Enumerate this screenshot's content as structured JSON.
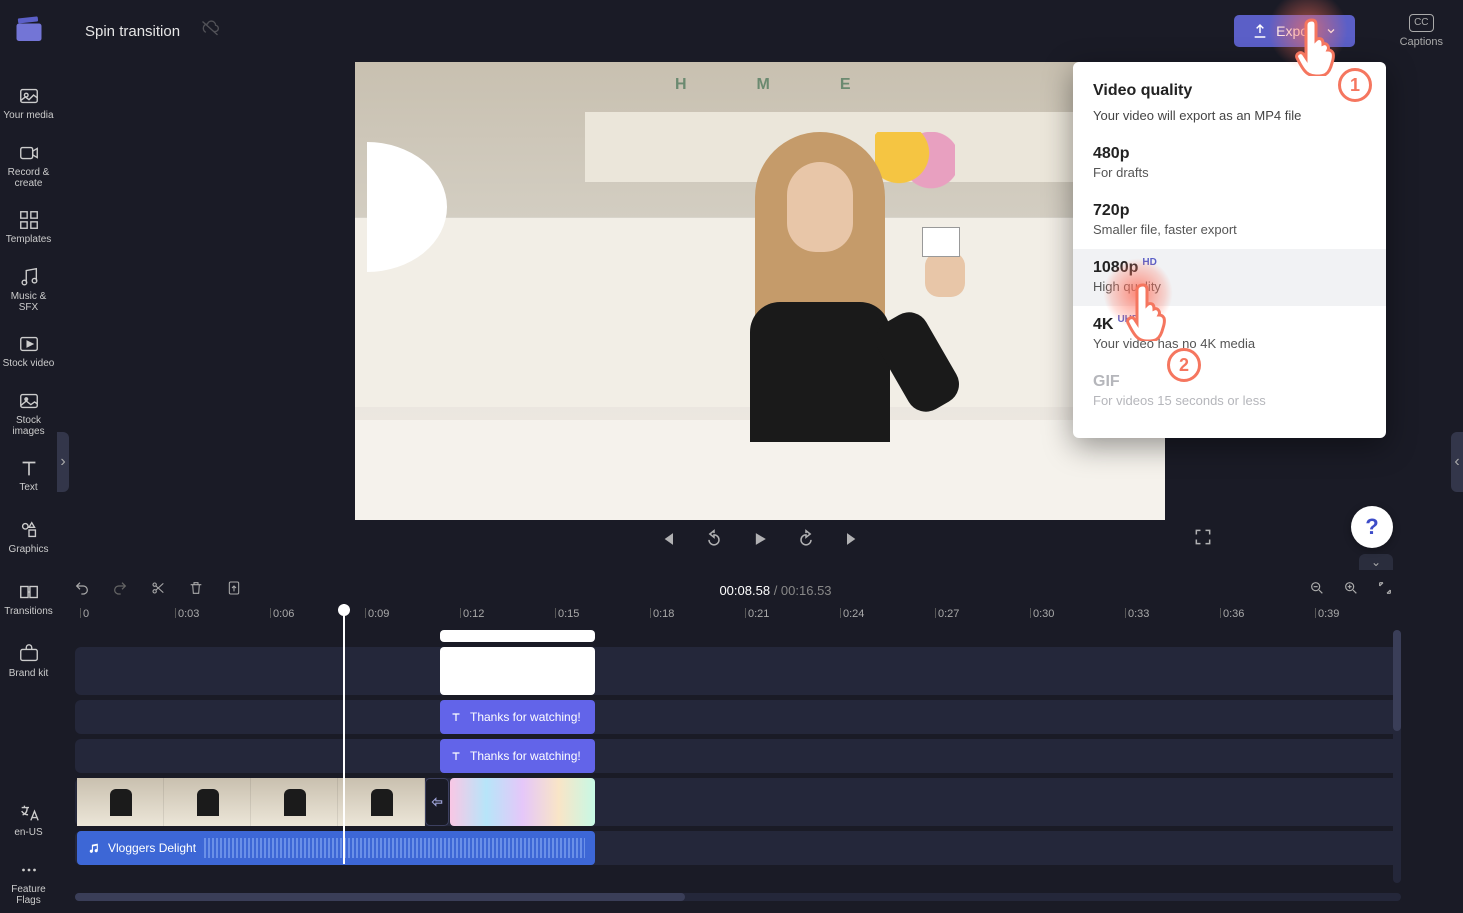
{
  "project_title": "Spin transition",
  "export_label": "Export",
  "captions_label": "Captions",
  "captions_cc": "CC",
  "sidebar": {
    "items": [
      {
        "label": "Your media"
      },
      {
        "label": "Record & create"
      },
      {
        "label": "Templates"
      },
      {
        "label": "Music & SFX"
      },
      {
        "label": "Stock video"
      },
      {
        "label": "Stock images"
      },
      {
        "label": "Text"
      },
      {
        "label": "Graphics"
      },
      {
        "label": "Transitions"
      },
      {
        "label": "Brand kit"
      }
    ],
    "footer": [
      {
        "label": "en-US"
      },
      {
        "label": "Feature Flags"
      }
    ]
  },
  "scene_letters": "HME",
  "playback": {
    "current": "00:08.58",
    "total": "00:16.53"
  },
  "ruler": [
    "0",
    "0:03",
    "0:06",
    "0:09",
    "0:12",
    "0:15",
    "0:18",
    "0:21",
    "0:24",
    "0:27",
    "0:30",
    "0:33",
    "0:36",
    "0:39"
  ],
  "tracks": {
    "caption1": "Thanks for watching!",
    "caption2": "Thanks for watching!",
    "audio_title": "Vloggers Delight"
  },
  "export_popup": {
    "title": "Video quality",
    "subtitle": "Your video will export as an MP4 file",
    "options": [
      {
        "name": "480p",
        "badge": "",
        "sub": "For drafts"
      },
      {
        "name": "720p",
        "badge": "",
        "sub": "Smaller file, faster export"
      },
      {
        "name": "1080p",
        "badge": "HD",
        "sub": "High quality"
      },
      {
        "name": "4K",
        "badge": "UHD",
        "sub": "Your video has no 4K media"
      },
      {
        "name": "GIF",
        "badge": "",
        "sub": "For videos 15 seconds or less"
      }
    ]
  },
  "help": "?",
  "annotations": {
    "num1": "1",
    "num2": "2"
  }
}
